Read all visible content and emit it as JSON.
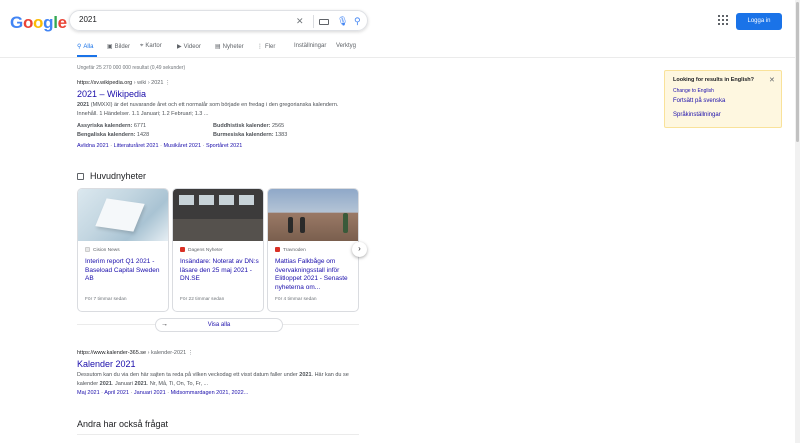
{
  "header": {
    "logo": "Google",
    "query": "2021",
    "login_label": "Logga in"
  },
  "tabs": [
    {
      "label": "Alla",
      "icon": "search-icon"
    },
    {
      "label": "Bilder",
      "icon": "image-icon"
    },
    {
      "label": "Kartor",
      "icon": "map-pin-icon"
    },
    {
      "label": "Videor",
      "icon": "video-icon"
    },
    {
      "label": "Nyheter",
      "icon": "news-icon"
    },
    {
      "label": "Fler",
      "icon": "more-vert-icon"
    },
    {
      "label": "Inställningar",
      "icon": ""
    },
    {
      "label": "Verktyg",
      "icon": ""
    }
  ],
  "result_stats": "Ungefär 25 270 000 000 resultat (0,49 sekunder)",
  "wiki": {
    "cite": "https://sv.wikipedia.org",
    "cite_path": " › wiki › 2021",
    "title": "2021 – Wikipedia",
    "snippet_bold": "2021",
    "snippet": " (MMXXI) är det nuvarande året och ett normalår som började en fredag i den gregorianska kalendern. Innehåll. 1 Händelser. 1.1 Januari; 1.2 Februari; 1.3 ...",
    "facts": [
      {
        "label": "Assyriska kalendern:",
        "value": "6771"
      },
      {
        "label": "Buddhistisk kalender:",
        "value": "2565"
      },
      {
        "label": "Bengaliska kalendern:",
        "value": "1428"
      },
      {
        "label": "Burmesiska kalendern:",
        "value": "1383"
      }
    ],
    "sublinks": [
      "Avlidna 2021",
      "Litteraturåret 2021",
      "Musikåret 2021",
      "Sportåret 2021"
    ]
  },
  "news": {
    "heading": "Huvudnyheter",
    "cards": [
      {
        "source": "Cision News",
        "title": "Interim report Q1 2021 - Baseload Capital Sweden AB",
        "time": "För 7 timmar sedan",
        "fav_color": "#e8e8e8"
      },
      {
        "source": "Dagens Nyheter",
        "title": "Insändare: Noterat av DN:s läsare den 25 maj 2021 - DN.SE",
        "time": "För 22 timmar sedan",
        "fav_color": "#d93025"
      },
      {
        "source": "Travnoden",
        "title": "Mattias Falkbåge om övervakningsstall inför Elitloppet 2021 - Senaste nyheterna om...",
        "time": "För 4 timmar sedan",
        "fav_color": "#d93025"
      }
    ],
    "show_all": "Visa alla"
  },
  "kalender": {
    "cite": "https://www.kalender-365.se",
    "cite_path": " › kalender-2021",
    "title": "Kalender 2021",
    "snippet_a": "Dessutom kan du via den här sajten ta reda på vilken veckodag ett visst datum faller under ",
    "b1": "2021",
    "snippet_b": ". Här kan du se kalender ",
    "b2": "2021",
    "snippet_c": ". Januari ",
    "b3": "2021",
    "snippet_d": ". Nr, Må, Ti, On, To, Fr, ...",
    "sublinks": [
      "Maj 2021",
      "April 2021",
      "Januari 2021",
      "Midsommardagen 2021, 2022..."
    ]
  },
  "paa": {
    "heading": "Andra har också frågat"
  },
  "lang_panel": {
    "heading": "Looking for results in English?",
    "change": "Change to English",
    "keep": "Fortsätt på svenska",
    "settings": "Språkinställningar",
    "close": "✕"
  },
  "colors": {
    "link": "#1a0dab",
    "accent": "#1a73e8",
    "panel_bg": "#fef7e0"
  }
}
